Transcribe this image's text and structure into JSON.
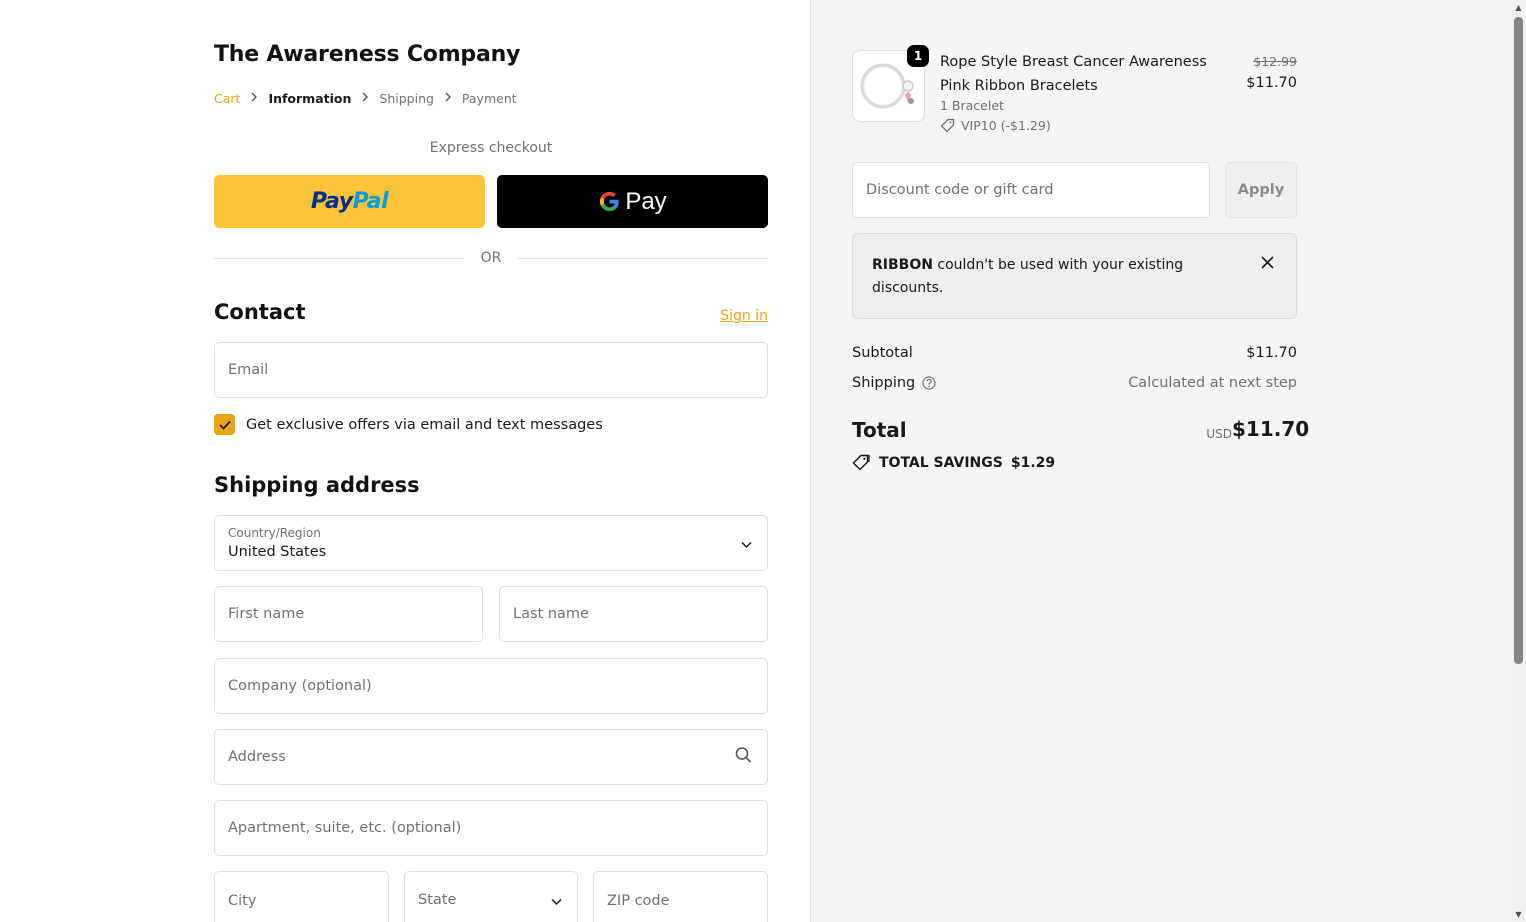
{
  "store": {
    "name": "The Awareness Company"
  },
  "breadcrumb": [
    "Cart",
    "Information",
    "Shipping",
    "Payment"
  ],
  "express": {
    "label": "Express checkout",
    "paypal_pay": "Pay",
    "paypal_pal": "Pal",
    "gpay_label": "Pay",
    "or": "OR"
  },
  "contact": {
    "heading": "Contact",
    "sign_in": "Sign in",
    "email_placeholder": "Email",
    "offers_label": "Get exclusive offers via email and text messages",
    "offers_checked": true
  },
  "shipping": {
    "heading": "Shipping address",
    "country_label": "Country/Region",
    "country_value": "United States",
    "first_name": "First name",
    "last_name": "Last name",
    "company": "Company (optional)",
    "address": "Address",
    "apartment": "Apartment, suite, etc. (optional)",
    "city": "City",
    "state": "State",
    "zip": "ZIP code"
  },
  "order": {
    "product": {
      "name": "Rope Style Breast Cancer Awareness Pink Ribbon Bracelets",
      "variant": "1 Bracelet",
      "discount": "VIP10 (-$1.29)",
      "quantity": "1",
      "price_original": "$12.99",
      "price": "$11.70"
    },
    "discount_placeholder": "Discount code or gift card",
    "apply": "Apply",
    "notice": {
      "code": "RIBBON",
      "message": " couldn't be used with your existing discounts."
    },
    "subtotal_label": "Subtotal",
    "subtotal": "$11.70",
    "shipping_label": "Shipping",
    "shipping_value": "Calculated at next step",
    "total_label": "Total",
    "currency": "USD",
    "total": "$11.70",
    "savings_label": "TOTAL SAVINGS",
    "savings": "$1.29"
  },
  "colors": {
    "accent": "#e8a317",
    "paypal": "#ffc439",
    "summary_bg": "#f5f5f5"
  }
}
